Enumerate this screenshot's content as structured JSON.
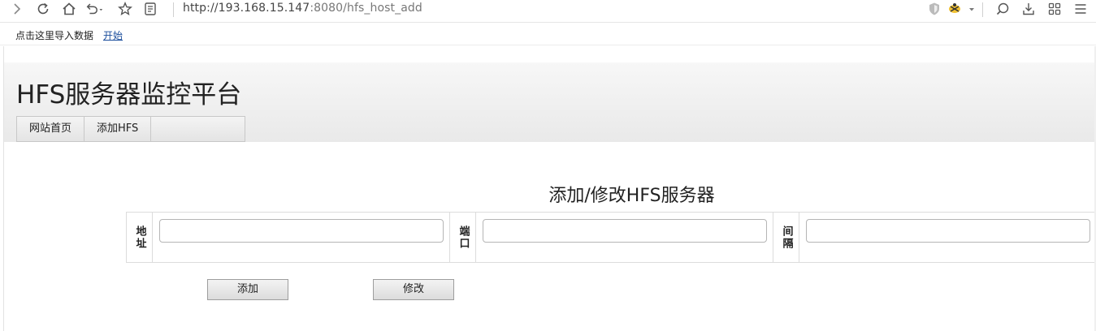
{
  "browser": {
    "url_host": "http://193.168.15.147",
    "url_rest": ":8080/hfs_host_add",
    "icons": [
      "forward-icon",
      "reload-icon",
      "home-icon",
      "undo-icon",
      "star-icon",
      "reader-icon",
      "shield-icon",
      "extension-icon",
      "search-icon",
      "download-icon",
      "apps-icon",
      "menu-icon"
    ]
  },
  "bookmarks": {
    "import_label": "点击这里导入数据",
    "start_label": "开始"
  },
  "header": {
    "site_title": "HFS服务器监控平台",
    "nav": [
      {
        "label": "网站首页"
      },
      {
        "label": "添加HFS"
      },
      {
        "label": ""
      }
    ]
  },
  "form": {
    "title": "添加/修改HFS服务器",
    "fields": [
      {
        "label": "地址",
        "value": "",
        "placeholder": ""
      },
      {
        "label": "端口",
        "value": "",
        "placeholder": ""
      },
      {
        "label": "间隔",
        "value": "",
        "placeholder": ""
      }
    ],
    "add_button": "添加",
    "edit_button": "修改"
  }
}
